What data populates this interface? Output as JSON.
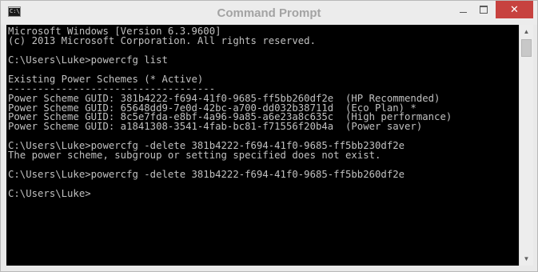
{
  "window": {
    "title": "Command Prompt",
    "icon_label": "C:\\_",
    "icon": "console-app-icon",
    "close_color": "#c7423f"
  },
  "controls": {
    "minimize": "minimize-icon",
    "maximize": "maximize-icon",
    "close": "✕"
  },
  "console": {
    "background": "#000000",
    "foreground": "#c0c0c0",
    "lines": [
      "Microsoft Windows [Version 6.3.9600]",
      "(c) 2013 Microsoft Corporation. All rights reserved.",
      "",
      "C:\\Users\\Luke>powercfg list",
      "",
      "Existing Power Schemes (* Active)",
      "-----------------------------------",
      "Power Scheme GUID: 381b4222-f694-41f0-9685-ff5bb260df2e  (HP Recommended)",
      "Power Scheme GUID: 65648dd9-7e0d-42bc-a700-dd032b38711d  (Eco Plan) *",
      "Power Scheme GUID: 8c5e7fda-e8bf-4a96-9a85-a6e23a8c635c  (High performance)",
      "Power Scheme GUID: a1841308-3541-4fab-bc81-f71556f20b4a  (Power saver)",
      "",
      "C:\\Users\\Luke>powercfg -delete 381b4222-f694-41f0-9685-ff5bb230df2e",
      "The power scheme, subgroup or setting specified does not exist.",
      "",
      "C:\\Users\\Luke>powercfg -delete 381b4222-f694-41f0-9685-ff5bb260df2e",
      "",
      "C:\\Users\\Luke>"
    ]
  },
  "scrollbar": {
    "up_arrow": "▲",
    "down_arrow": "▼"
  }
}
